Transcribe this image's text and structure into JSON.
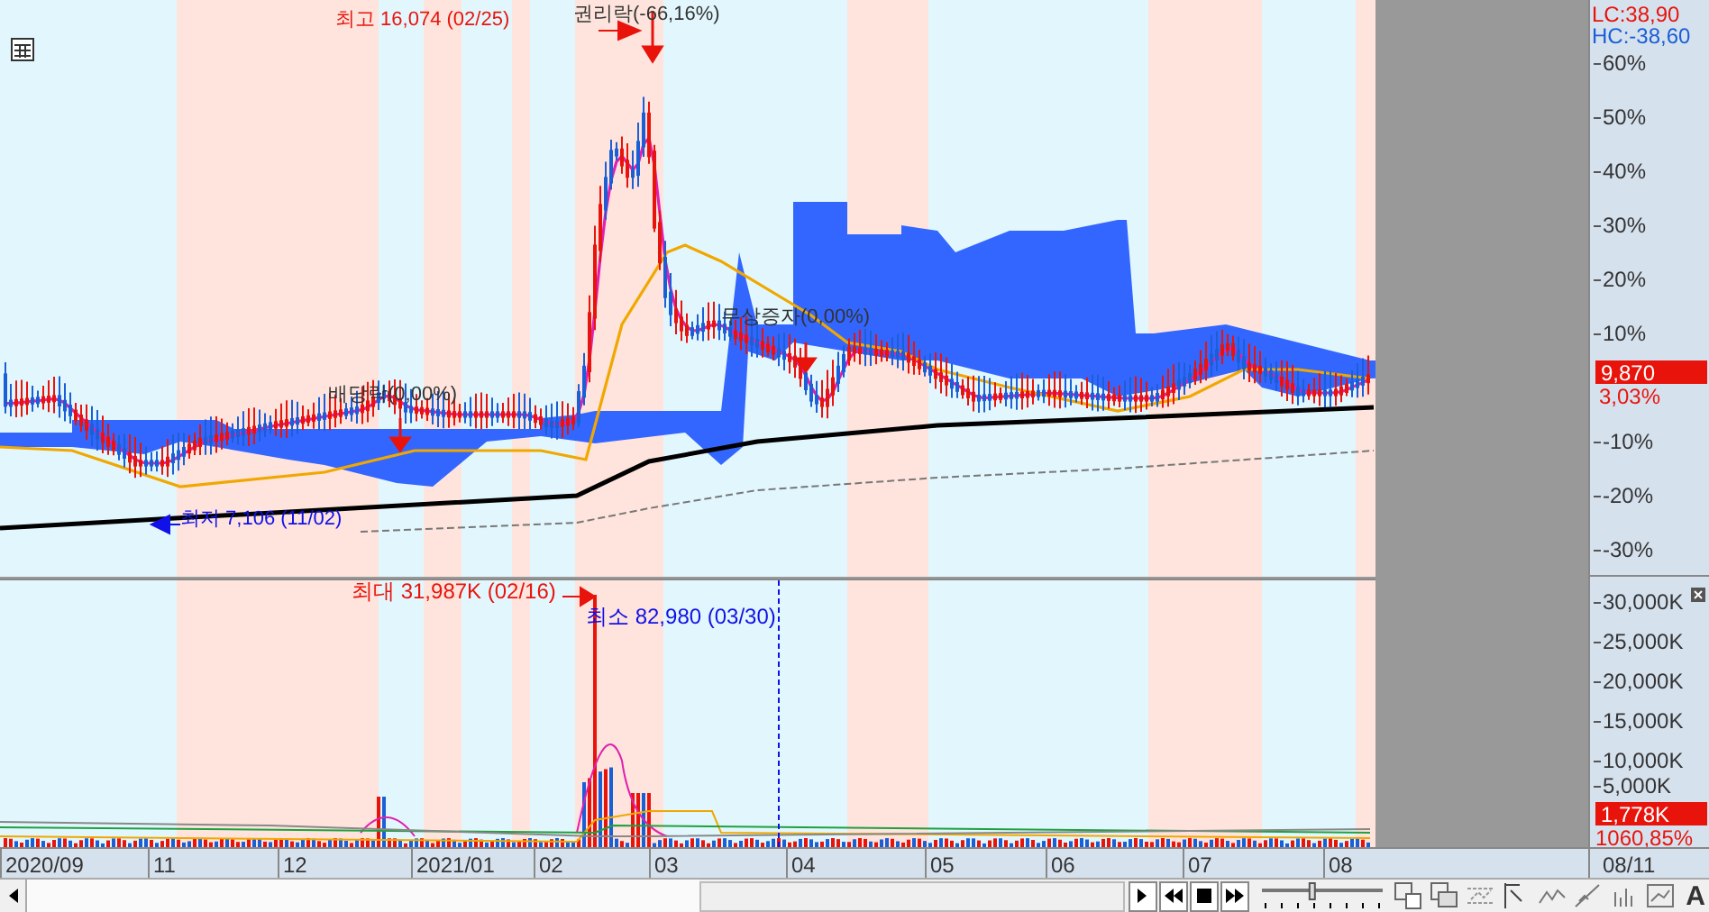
{
  "price_panel": {
    "annotations": [
      {
        "kind": "high",
        "text": "최고 16,074 (02/25)"
      },
      {
        "kind": "event",
        "text": "권리락(-66,16%)"
      },
      {
        "kind": "event",
        "text": "배당락(0,00%)"
      },
      {
        "kind": "event",
        "text": "무상증자(0,00%)"
      },
      {
        "kind": "low",
        "text": "최저 7,106 (11/02)"
      }
    ],
    "axis": {
      "lc": "LC:38,90",
      "hc": "HC:-38,60",
      "ticks": [
        "60%",
        "50%",
        "40%",
        "30%",
        "20%",
        "10%",
        "-10%",
        "-20%",
        "-30%"
      ],
      "current_price": "9,870",
      "current_change": "3,03%"
    }
  },
  "volume_panel": {
    "annotations": [
      {
        "kind": "high",
        "text": "최대 31,987K (02/16)"
      },
      {
        "kind": "low",
        "text": "최소 82,980 (03/30)"
      }
    ],
    "axis": {
      "ticks": [
        "30,000K",
        "25,000K",
        "20,000K",
        "15,000K",
        "10,000K",
        "5,000K"
      ],
      "current_volume": "1,778K",
      "current_change": "1060,85%"
    }
  },
  "date_axis": {
    "labels": [
      "2020/09",
      "11",
      "12",
      "2021/01",
      "02",
      "03",
      "04",
      "05",
      "06",
      "07",
      "08"
    ],
    "current_date": "08/11"
  },
  "toolbar": {
    "speed_slider": {
      "level": 0.4
    },
    "text_button": "A"
  }
}
